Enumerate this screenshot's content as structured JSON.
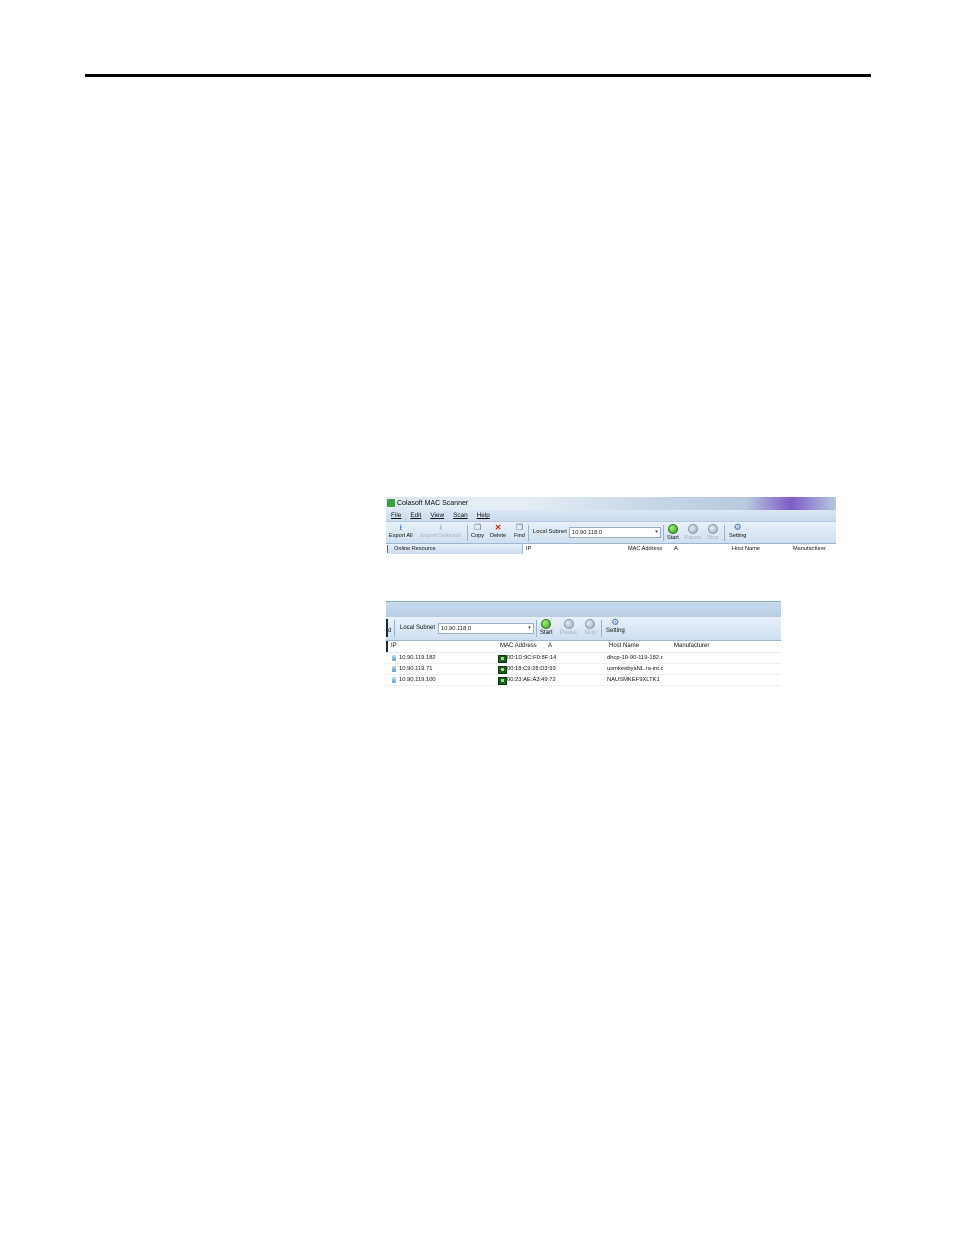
{
  "screenshot1": {
    "title": "Colasoft MAC Scanner",
    "menu": [
      "File",
      "Edit",
      "View",
      "Scan",
      "Help"
    ],
    "toolbar": {
      "export_all": "Export All",
      "export_selected": "Export Selected",
      "copy": "Copy",
      "delete": "Delete",
      "find": "Find",
      "subnet_label": "Local Subnet",
      "subnet_value": "10.90.118.0",
      "start": "Start",
      "pause": "Pause",
      "stop": "Stop",
      "setting": "Setting"
    },
    "header": {
      "online_resource": "Online Resource",
      "ip": "IP",
      "mac": "MAC Address",
      "sort": "A",
      "host": "Host Name",
      "manufacturer": "Manufacturer"
    }
  },
  "screenshot2": {
    "toolbar": {
      "cut_label": "d",
      "subnet_label": "Local Subnet",
      "subnet_value": "10.90.118.0",
      "start": "Start",
      "pause": "Pause",
      "stop": "Stop",
      "setting": "Setting"
    },
    "header": {
      "ip": "IP",
      "mac": "MAC Address",
      "sort": "A",
      "host": "Host Name",
      "manufacturer": "Manufacturer"
    },
    "rows": [
      {
        "ip": "10.90.119.182",
        "mac": "00:1D:9C:F0:8F:14",
        "host": "dhcp-10-90-119-182.r"
      },
      {
        "ip": "10.90.119.71",
        "mac": "00:18:C9:28:D3:93",
        "host": "usmkeebyaNL.ra-int.c"
      },
      {
        "ip": "10.90.119.100",
        "mac": "00:23:AE:A3:49:72",
        "host": "NAUSMKEF9XLTK1"
      }
    ]
  },
  "icons": {
    "export_all": "export-icon",
    "export_selected": "export-selected-icon",
    "copy": "copy-icon",
    "delete": "delete-x-icon",
    "find": "find-icon",
    "start": "start-green-circle-icon",
    "pause": "pause-icon",
    "stop": "stop-icon",
    "setting": "setting-gear-icon"
  }
}
